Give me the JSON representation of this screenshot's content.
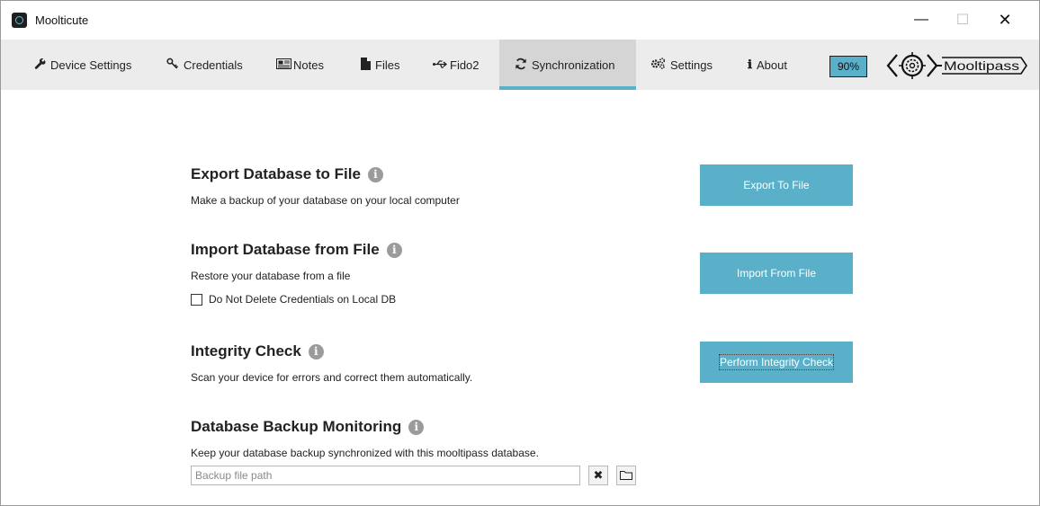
{
  "window": {
    "title": "Moolticute",
    "minimize_glyph": "—",
    "maximize_glyph": "☐",
    "close_glyph": "✕"
  },
  "tabs": [
    {
      "label": "Device Settings",
      "icon": "wrench-icon",
      "glyph": "🔧",
      "active": false
    },
    {
      "label": "Credentials",
      "icon": "key-icon",
      "glyph": "🔑",
      "active": false
    },
    {
      "label": "Notes",
      "icon": "notes-icon",
      "glyph": "▤",
      "active": false
    },
    {
      "label": "Files",
      "icon": "file-icon",
      "glyph": "▮",
      "active": false
    },
    {
      "label": "Fido2",
      "icon": "usb-icon",
      "glyph": "⇆",
      "active": false
    },
    {
      "label": "Synchronization",
      "icon": "refresh-icon",
      "glyph": "⟳",
      "active": true
    },
    {
      "label": "Settings",
      "icon": "gears-icon",
      "glyph": "⚙",
      "active": false
    },
    {
      "label": "About",
      "icon": "info-icon",
      "glyph": "ℹ",
      "active": false
    }
  ],
  "battery": {
    "level_text": "90%",
    "color": "#5aafc9"
  },
  "logo": {
    "text": "Mooltipass"
  },
  "sections": {
    "export": {
      "title": "Export Database to File",
      "description": "Make a backup of your database on your local computer",
      "button": "Export To File"
    },
    "import": {
      "title": "Import Database from File",
      "description": "Restore your database from a file",
      "checkbox_label": "Do Not Delete Credentials on Local DB",
      "checkbox_checked": false,
      "button": "Import From File"
    },
    "integrity": {
      "title": "Integrity Check",
      "description": "Scan your device for errors and correct them automatically.",
      "button": "Perform Integrity Check"
    },
    "monitoring": {
      "title": "Database Backup Monitoring",
      "description": "Keep your database backup synchronized with this mooltipass database.",
      "path_placeholder": "Backup file path",
      "path_value": "",
      "clear_glyph": "✖",
      "browse_glyph": "🗀"
    }
  },
  "colors": {
    "accent": "#5aafc9",
    "tabbar_bg": "#ececec",
    "active_tab_bg": "#d5d5d5",
    "info_icon": "#9b9b9b"
  }
}
